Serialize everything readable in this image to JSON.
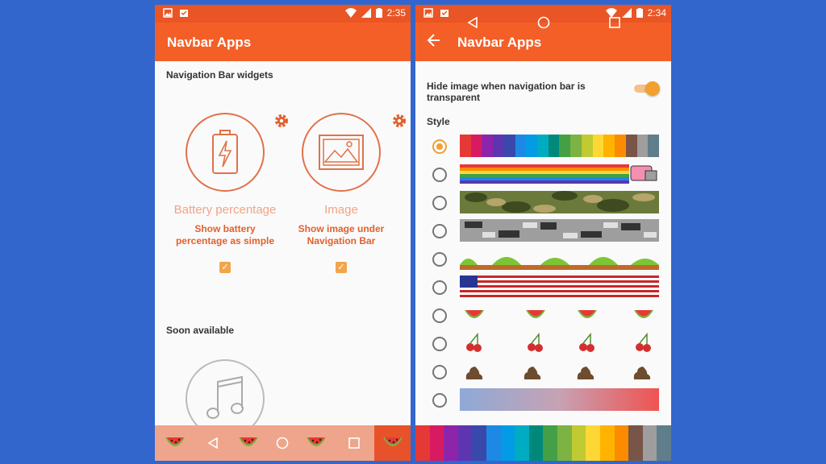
{
  "left": {
    "status": {
      "time": "2:35"
    },
    "appbar": {
      "title": "Navbar Apps"
    },
    "section_widgets": "Navigation Bar widgets",
    "widgets": [
      {
        "name": "Battery percentage",
        "desc": "Show battery percentage as simple",
        "checked": true
      },
      {
        "name": "Image",
        "desc": "Show image under Navigation Bar",
        "checked": true
      }
    ],
    "section_soon": "Soon available",
    "navbar_colors": {
      "bg": "#efa58b",
      "accent": "#e8522a"
    }
  },
  "right": {
    "status": {
      "time": "2:34"
    },
    "appbar": {
      "title": "Navbar Apps"
    },
    "toggle_label": "Hide image when navigation bar is transparent",
    "toggle_on": true,
    "section_style": "Style",
    "styles": [
      "rainbow-stripes",
      "nyan-cat",
      "camo-green",
      "camo-gray",
      "mario-level",
      "us-flag",
      "watermelon",
      "cherry",
      "poop",
      "gradient"
    ],
    "selected_style": 0,
    "fab_label": "+"
  },
  "palette": [
    "#e53935",
    "#d81b60",
    "#8e24aa",
    "#5e35b1",
    "#3949ab",
    "#1e88e5",
    "#039be5",
    "#00acc1",
    "#00897b",
    "#43a047",
    "#7cb342",
    "#c0ca33",
    "#fdd835",
    "#ffb300",
    "#fb8c00",
    "#795548",
    "#9e9e9e",
    "#607d8b"
  ],
  "colors": {
    "status_bar": "#ea5525",
    "app_bar": "#f45f28",
    "accent": "#f2a030",
    "background": "#3366cc"
  }
}
